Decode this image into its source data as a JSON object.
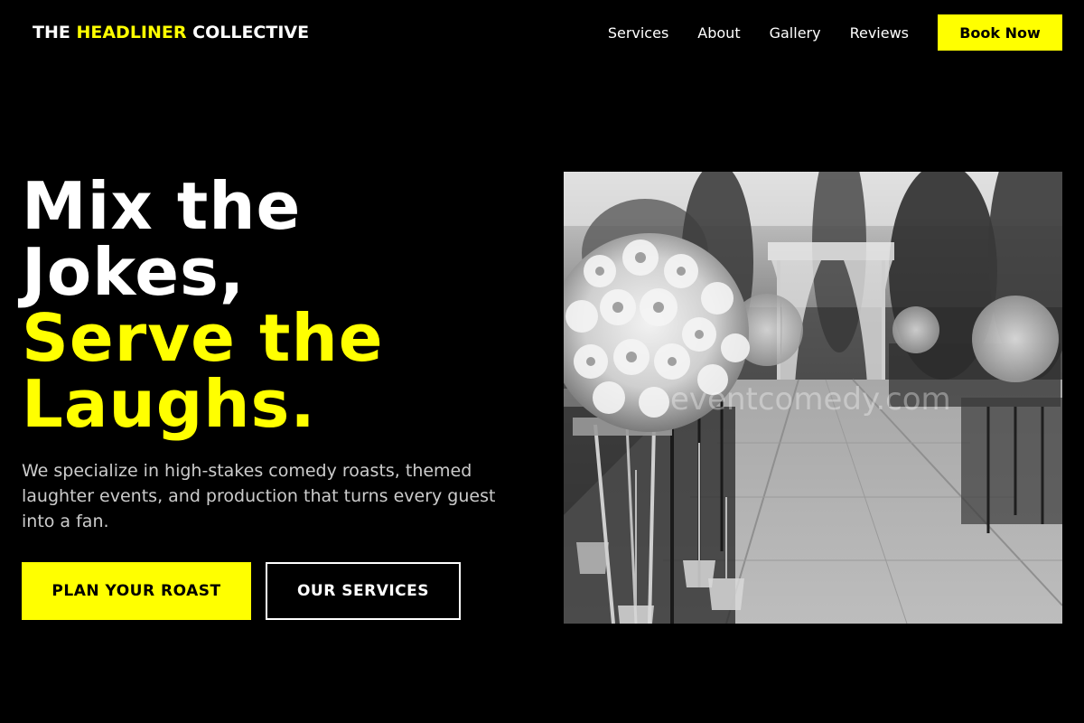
{
  "header": {
    "logo_part1": "THE ",
    "logo_accent": "HEADLINER",
    "logo_part2": " COLLECTIVE",
    "nav": [
      "Services",
      "About",
      "Gallery",
      "Reviews"
    ],
    "cta": "Book Now"
  },
  "hero": {
    "title_line1": "Mix the",
    "title_line2": "Jokes,",
    "title_line3": "Serve the",
    "title_line4": "Laughs.",
    "description": "We specialize in high-stakes comedy roasts, themed laughter events, and production that turns every guest into a fan.",
    "primary_button": "PLAN YOUR ROAST",
    "secondary_button": "OUR SERVICES"
  },
  "photo": {
    "watermark": "eventcomedy.com"
  },
  "colors": {
    "background": "#000000",
    "accent": "#ffff00",
    "text": "#ffffff",
    "muted_text": "#cccccc"
  }
}
